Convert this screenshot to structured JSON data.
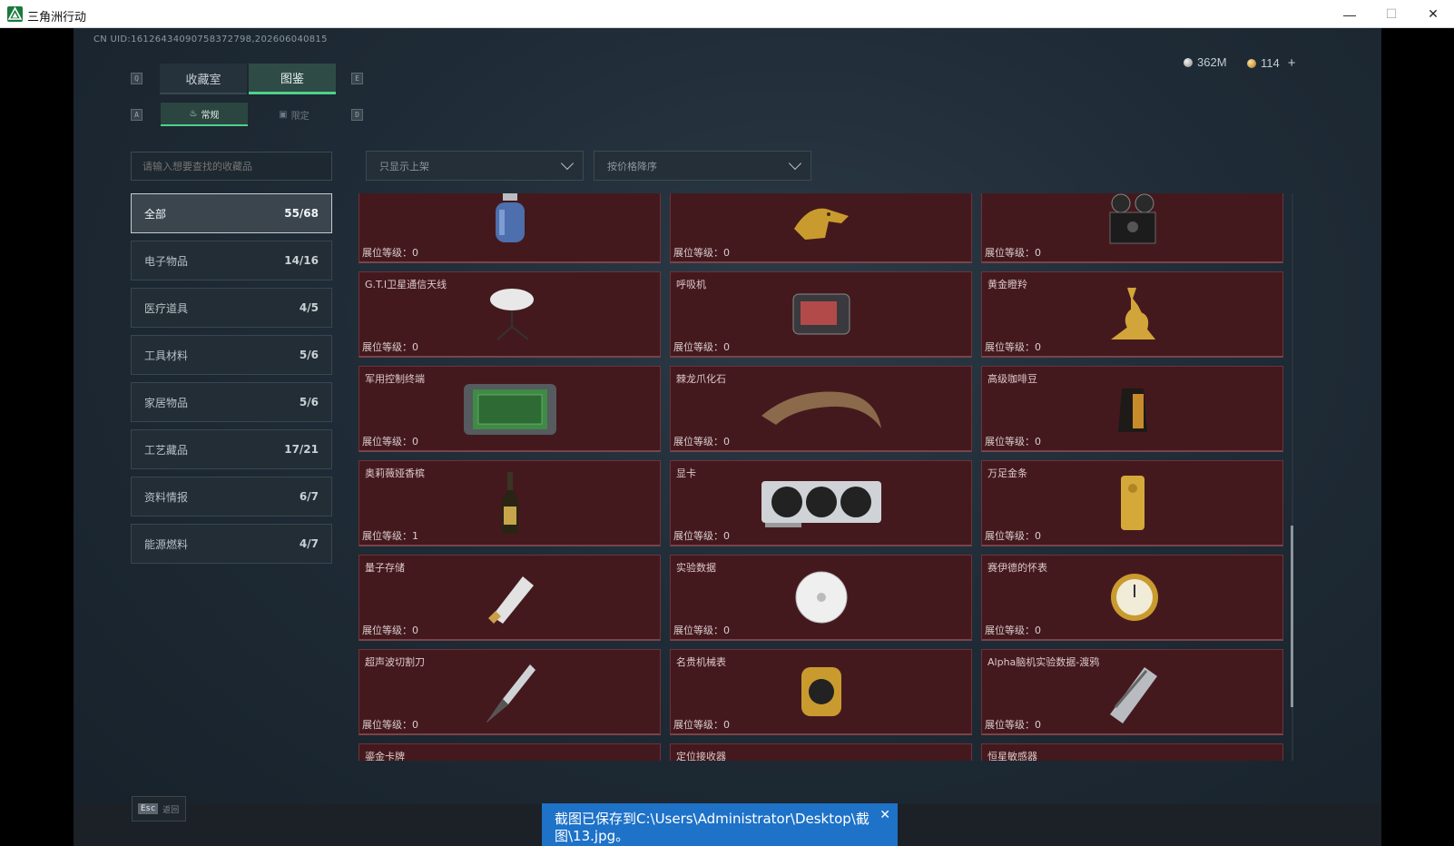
{
  "window": {
    "title": "三角洲行动",
    "min_icon": "—",
    "max_icon": "☐",
    "close_icon": "✕"
  },
  "header": {
    "uid": "CN UID:16126434090758372798,202606040815",
    "currency_silver": "362M",
    "currency_gold": "114",
    "add_label": "+"
  },
  "tabs": {
    "key_left": "Q",
    "key_right": "E",
    "items": [
      {
        "label": "收藏室"
      },
      {
        "label": "图鉴"
      }
    ],
    "active_index": 1
  },
  "subtabs": {
    "key_left": "A",
    "key_right": "D",
    "items": [
      {
        "label": "常规"
      },
      {
        "label": "限定"
      }
    ],
    "active_index": 0
  },
  "search": {
    "placeholder": "请输入想要查找的收藏品"
  },
  "filters": {
    "shelf": "只显示上架",
    "sort": "按价格降序"
  },
  "categories": [
    {
      "label": "全部",
      "count": "55/68"
    },
    {
      "label": "电子物品",
      "count": "14/16"
    },
    {
      "label": "医疗道具",
      "count": "4/5"
    },
    {
      "label": "工具材料",
      "count": "5/6"
    },
    {
      "label": "家居物品",
      "count": "5/6"
    },
    {
      "label": "工艺藏品",
      "count": "17/21"
    },
    {
      "label": "资料情报",
      "count": "6/7"
    },
    {
      "label": "能源燃料",
      "count": "4/7"
    }
  ],
  "level_label": "展位等级：",
  "items": [
    {
      "name": "",
      "level": "0",
      "icon": "gas-tank"
    },
    {
      "name": "",
      "level": "0",
      "icon": "golden-dragon-head"
    },
    {
      "name": "",
      "level": "0",
      "icon": "reel-projector"
    },
    {
      "name": "G.T.I卫星通信天线",
      "level": "0",
      "icon": "satellite-dish"
    },
    {
      "name": "呼吸机",
      "level": "0",
      "icon": "ventilator"
    },
    {
      "name": "黄金瞪羚",
      "level": "0",
      "icon": "golden-gazelle"
    },
    {
      "name": "军用控制终端",
      "level": "0",
      "icon": "control-terminal"
    },
    {
      "name": "棘龙爪化石",
      "level": "0",
      "icon": "claw-fossil"
    },
    {
      "name": "高级咖啡豆",
      "level": "0",
      "icon": "coffee-bag"
    },
    {
      "name": "奥莉薇娅香槟",
      "level": "1",
      "icon": "champagne-bottle"
    },
    {
      "name": "显卡",
      "level": "0",
      "icon": "graphics-card"
    },
    {
      "name": "万足金条",
      "level": "0",
      "icon": "gold-bar"
    },
    {
      "name": "量子存储",
      "level": "0",
      "icon": "quantum-usb"
    },
    {
      "name": "实验数据",
      "level": "0",
      "icon": "data-disc"
    },
    {
      "name": "赛伊德的怀表",
      "level": "0",
      "icon": "pocket-watch"
    },
    {
      "name": "超声波切割刀",
      "level": "0",
      "icon": "ultrasonic-knife"
    },
    {
      "name": "名贵机械表",
      "level": "0",
      "icon": "wrist-watch"
    },
    {
      "name": "Alpha脑机实验数据-渡鸦",
      "level": "0",
      "icon": "alpha-data-canister"
    },
    {
      "name": "鎏金卡牌",
      "level": "",
      "icon": "gilded-card"
    },
    {
      "name": "定位接收器",
      "level": "",
      "icon": "locator-receiver"
    },
    {
      "name": "恒星敏感器",
      "level": "",
      "icon": "star-sensor"
    }
  ],
  "footer": {
    "esc_key": "Esc",
    "back_label": "返回"
  },
  "toast": {
    "message": "截图已保存到C:\\Users\\Administrator\\Desktop\\截图\\13.jpg。",
    "close_icon": "✕"
  },
  "colors": {
    "accent": "#4fd18b",
    "card_bg": "#44191e",
    "toast_bg": "#1e72c8"
  }
}
